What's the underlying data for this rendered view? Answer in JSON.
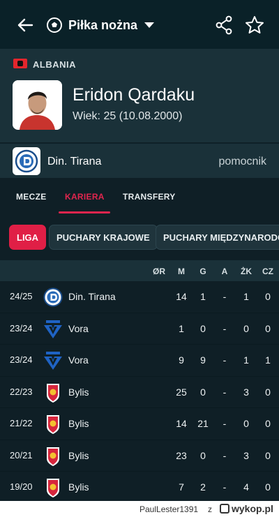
{
  "topbar": {
    "sport_title": "Piłka nożna"
  },
  "player": {
    "country": "ALBANIA",
    "name": "Eridon Qardaku",
    "age": "Wiek: 25 (10.08.2000)"
  },
  "team": {
    "name": "Din. Tirana",
    "position": "pomocnik"
  },
  "tabs": [
    {
      "label": "MECZE"
    },
    {
      "label": "KARIERA"
    },
    {
      "label": "TRANSFERY"
    }
  ],
  "chips": [
    {
      "label": "LIGA"
    },
    {
      "label": "PUCHARY KRAJOWE"
    },
    {
      "label": "PUCHARY MIĘDZYNARODOWE"
    }
  ],
  "table": {
    "headers": [
      "ØR",
      "M",
      "G",
      "A",
      "ŻK",
      "CZ"
    ],
    "rows": [
      {
        "season": "24/25",
        "club": "Din. Tirana",
        "logo": "dinamo-crest",
        "rating": "",
        "m": "14",
        "g": "1",
        "a": "-",
        "yk": "1",
        "rc": "0"
      },
      {
        "season": "23/24",
        "club": "Vora",
        "logo": "vora-crest",
        "rating": "",
        "m": "1",
        "g": "0",
        "a": "-",
        "yk": "0",
        "rc": "0"
      },
      {
        "season": "23/24",
        "club": "Vora",
        "logo": "vora-crest",
        "rating": "",
        "m": "9",
        "g": "9",
        "a": "-",
        "yk": "1",
        "rc": "1"
      },
      {
        "season": "22/23",
        "club": "Bylis",
        "logo": "bylis-crest",
        "rating": "",
        "m": "25",
        "g": "0",
        "a": "-",
        "yk": "3",
        "rc": "0"
      },
      {
        "season": "21/22",
        "club": "Bylis",
        "logo": "bylis-crest",
        "rating": "",
        "m": "14",
        "g": "21",
        "a": "-",
        "yk": "0",
        "rc": "0"
      },
      {
        "season": "20/21",
        "club": "Bylis",
        "logo": "bylis-crest",
        "rating": "",
        "m": "23",
        "g": "0",
        "a": "-",
        "yk": "3",
        "rc": "0"
      },
      {
        "season": "19/20",
        "club": "Bylis",
        "logo": "bylis-crest",
        "rating": "",
        "m": "7",
        "g": "2",
        "a": "-",
        "yk": "4",
        "rc": "0"
      }
    ]
  },
  "footer": {
    "user": "PaulLester1391",
    "sep": "z",
    "site": "wykop.pl"
  },
  "colors": {
    "accent": "#e2254e",
    "background": "#0f1f26",
    "panel": "#1a3139"
  }
}
